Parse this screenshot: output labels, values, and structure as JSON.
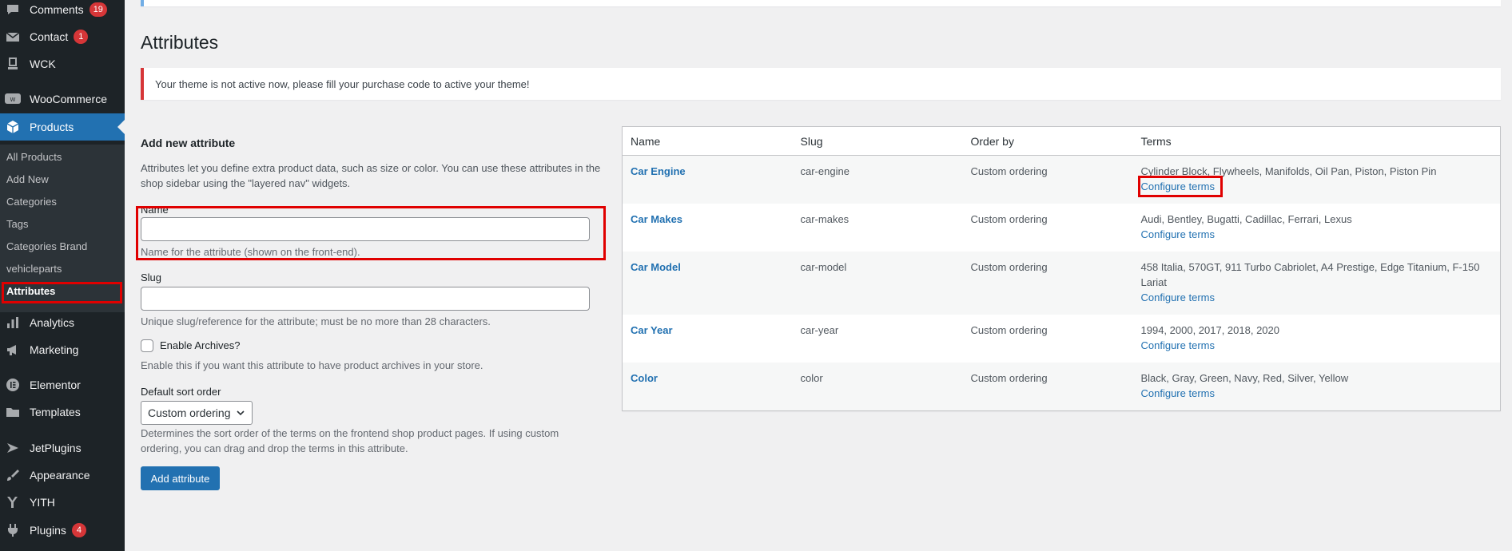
{
  "sidebar": {
    "items": [
      {
        "label": "Comments",
        "icon": "comments-icon",
        "badge": "19"
      },
      {
        "label": "Contact",
        "icon": "mail-icon",
        "badge": "1"
      },
      {
        "label": "WCK",
        "icon": "wck-icon"
      },
      {
        "label": "WooCommerce",
        "icon": "woocommerce-icon"
      },
      {
        "label": "Products",
        "icon": "products-icon"
      },
      {
        "label": "Analytics",
        "icon": "analytics-icon"
      },
      {
        "label": "Marketing",
        "icon": "megaphone-icon"
      },
      {
        "label": "Elementor",
        "icon": "elementor-icon"
      },
      {
        "label": "Templates",
        "icon": "folder-icon"
      },
      {
        "label": "JetPlugins",
        "icon": "jet-icon"
      },
      {
        "label": "Appearance",
        "icon": "brush-icon"
      },
      {
        "label": "YITH",
        "icon": "yith-icon"
      },
      {
        "label": "Plugins",
        "icon": "plugin-icon",
        "badge": "4"
      }
    ],
    "submenu": [
      "All Products",
      "Add New",
      "Categories",
      "Tags",
      "Categories Brand",
      "vehicleparts",
      "Attributes"
    ]
  },
  "page": {
    "title": "Attributes",
    "notice": "Your theme is not active now, please fill your purchase code to active your theme!"
  },
  "form": {
    "heading": "Add new attribute",
    "intro": "Attributes let you define extra product data, such as size or color. You can use these attributes in the shop sidebar using the \"layered nav\" widgets.",
    "name_label": "Name",
    "name_value": "",
    "name_help": "Name for the attribute (shown on the front-end).",
    "slug_label": "Slug",
    "slug_value": "",
    "slug_help": "Unique slug/reference for the attribute; must be no more than 28 characters.",
    "archives_label": "Enable Archives?",
    "archives_help": "Enable this if you want this attribute to have product archives in your store.",
    "sort_label": "Default sort order",
    "sort_value": "Custom ordering",
    "sort_help": "Determines the sort order of the terms on the frontend shop product pages. If using custom ordering, you can drag and drop the terms in this attribute.",
    "submit_label": "Add attribute"
  },
  "table": {
    "headers": {
      "name": "Name",
      "slug": "Slug",
      "order": "Order by",
      "terms": "Terms"
    },
    "configure_label": "Configure terms",
    "rows": [
      {
        "name": "Car Engine",
        "slug": "car-engine",
        "order": "Custom ordering",
        "terms": "Cylinder Block, Flywheels, Manifolds, Oil Pan, Piston, Piston Pin"
      },
      {
        "name": "Car Makes",
        "slug": "car-makes",
        "order": "Custom ordering",
        "terms": "Audi, Bentley, Bugatti, Cadillac, Ferrari, Lexus"
      },
      {
        "name": "Car Model",
        "slug": "car-model",
        "order": "Custom ordering",
        "terms": "458 Italia, 570GT, 911 Turbo Cabriolet, A4 Prestige, Edge Titanium, F-150 Lariat"
      },
      {
        "name": "Car Year",
        "slug": "car-year",
        "order": "Custom ordering",
        "terms": "1994, 2000, 2017, 2018, 2020"
      },
      {
        "name": "Color",
        "slug": "color",
        "order": "Custom ordering",
        "terms": "Black, Gray, Green, Navy, Red, Silver, Yellow"
      }
    ]
  },
  "colors": {
    "accent": "#2271b1",
    "sidebar": "#1d2327",
    "badge": "#d63638",
    "highlight": "#e00000"
  }
}
